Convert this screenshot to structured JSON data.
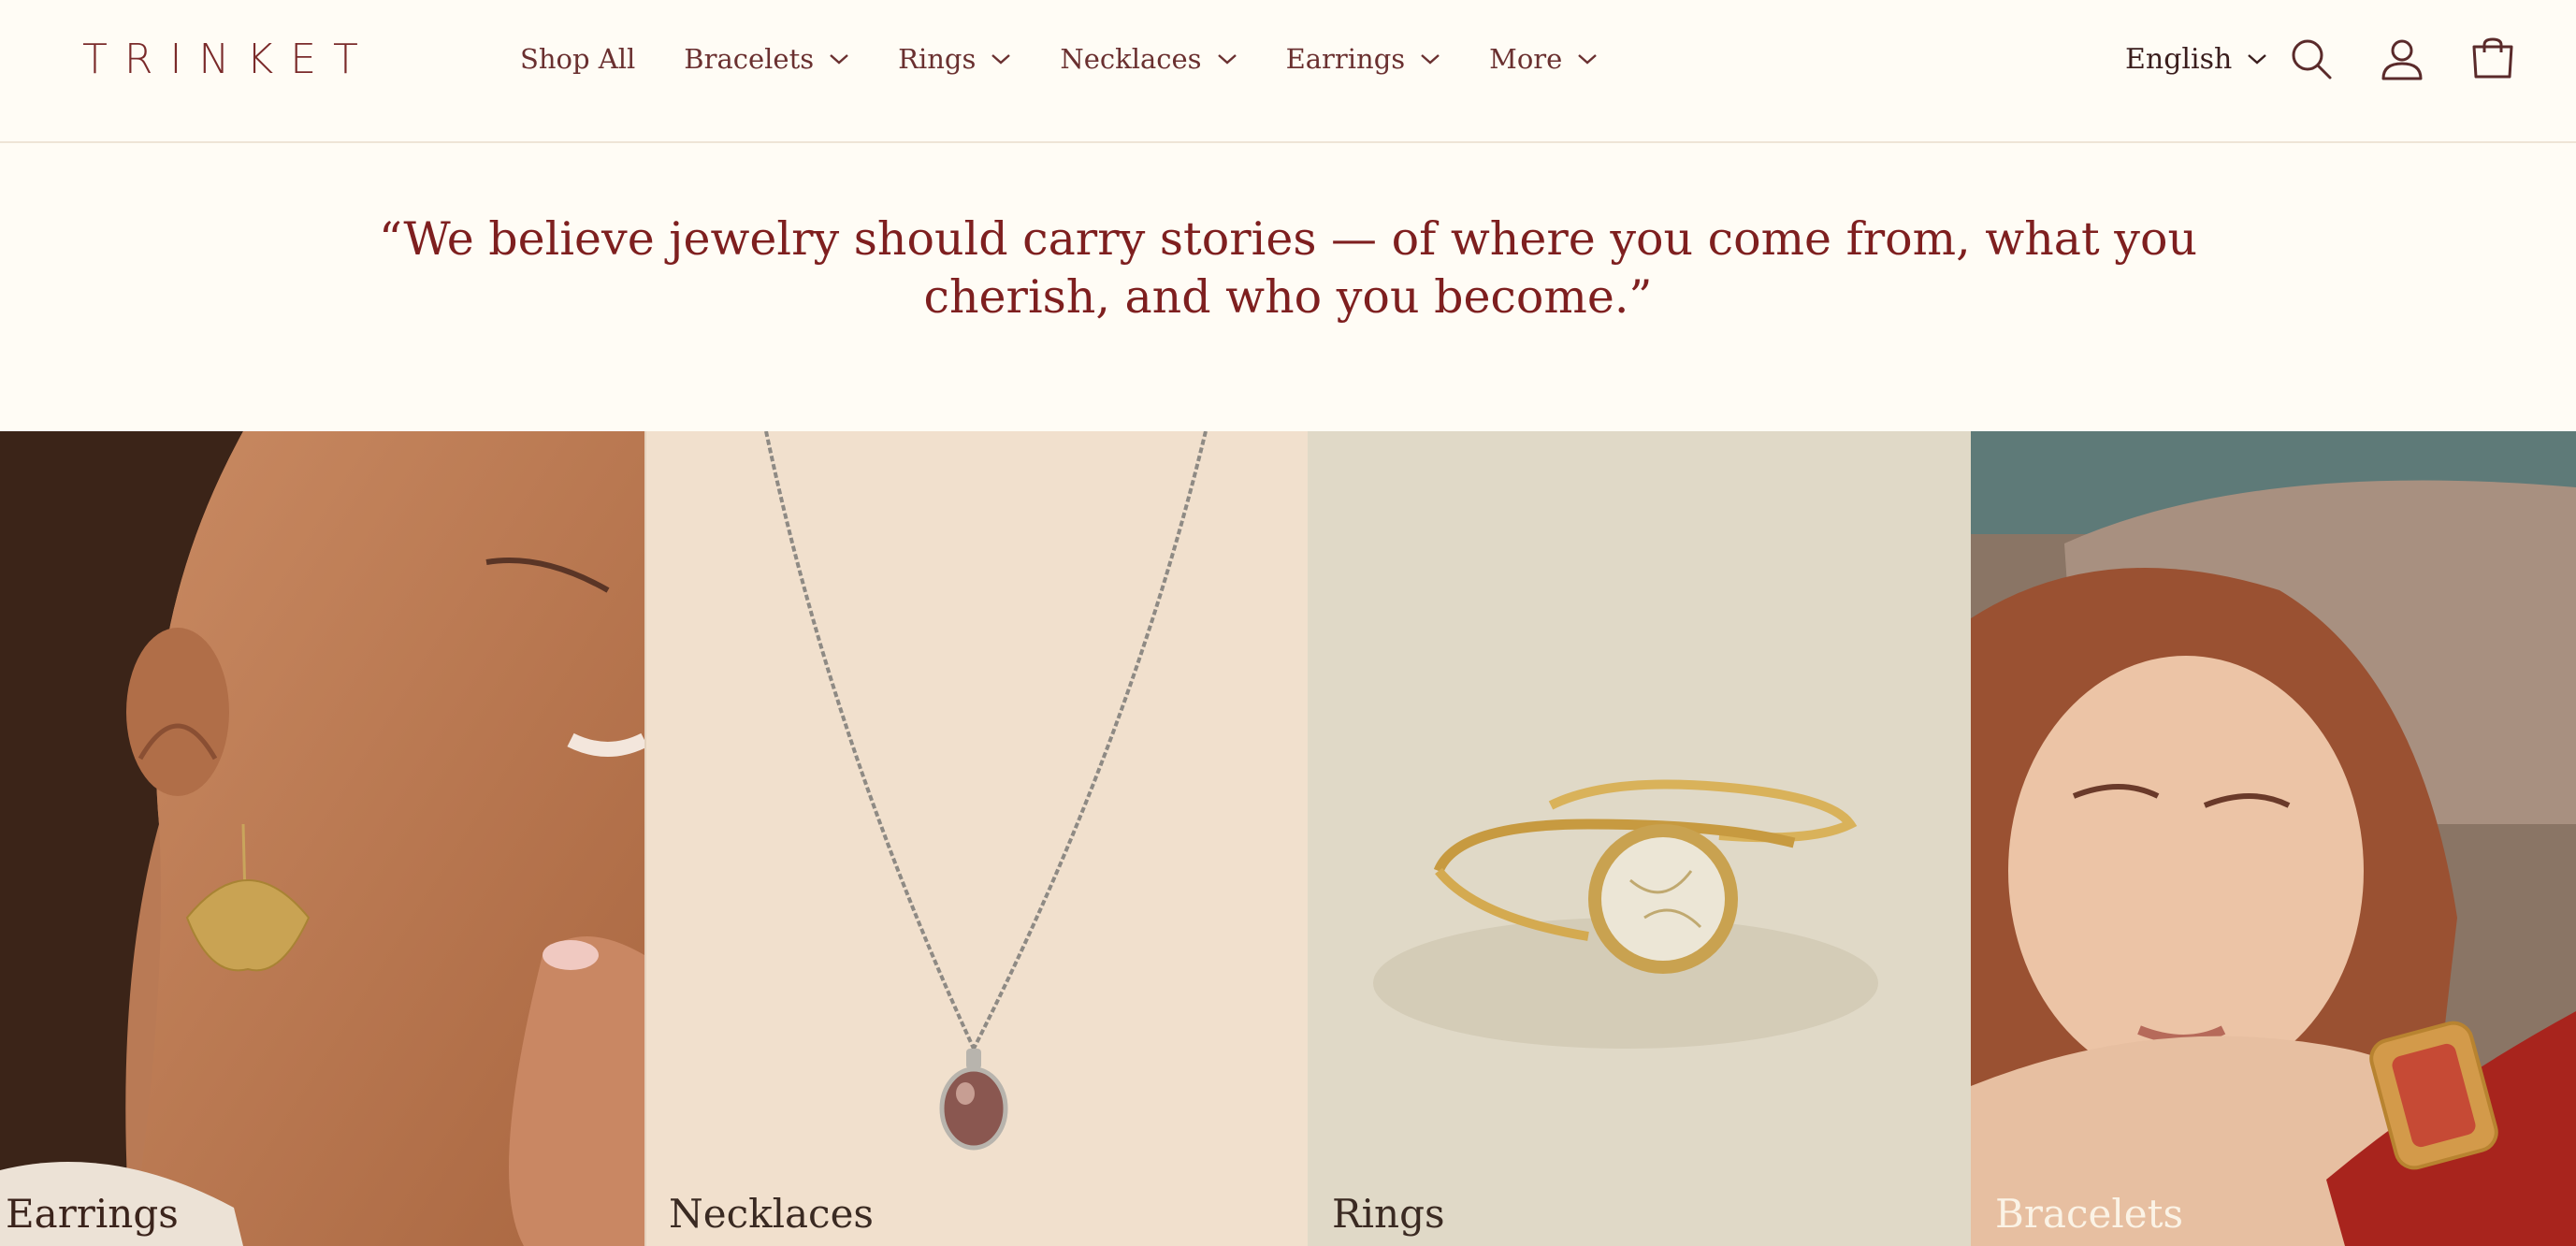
{
  "brand": {
    "logo_text": "TRINKET"
  },
  "nav": {
    "items": [
      {
        "label": "Shop All",
        "has_dropdown": false
      },
      {
        "label": "Bracelets",
        "has_dropdown": true
      },
      {
        "label": "Rings",
        "has_dropdown": true
      },
      {
        "label": "Necklaces",
        "has_dropdown": true
      },
      {
        "label": "Earrings",
        "has_dropdown": true
      },
      {
        "label": "More",
        "has_dropdown": true
      }
    ]
  },
  "header_actions": {
    "language": "English",
    "icons": [
      "search-icon",
      "account-icon",
      "cart-icon"
    ]
  },
  "quote": {
    "line1": "“We believe jewelry should carry stories — of where you come from, what you",
    "line2": "cherish, and who you become.”"
  },
  "collections": [
    {
      "label": "Earrings",
      "image": "woman-with-ginkgo-earring"
    },
    {
      "label": "Necklaces",
      "image": "pendant-necklace"
    },
    {
      "label": "Rings",
      "image": "gold-stone-ring"
    },
    {
      "label": "Bracelets",
      "image": "woman-with-cuff-bracelet"
    }
  ],
  "colors": {
    "background": "#fffcf5",
    "brand": "#7a2a2a",
    "quote": "#7e1f1f"
  }
}
